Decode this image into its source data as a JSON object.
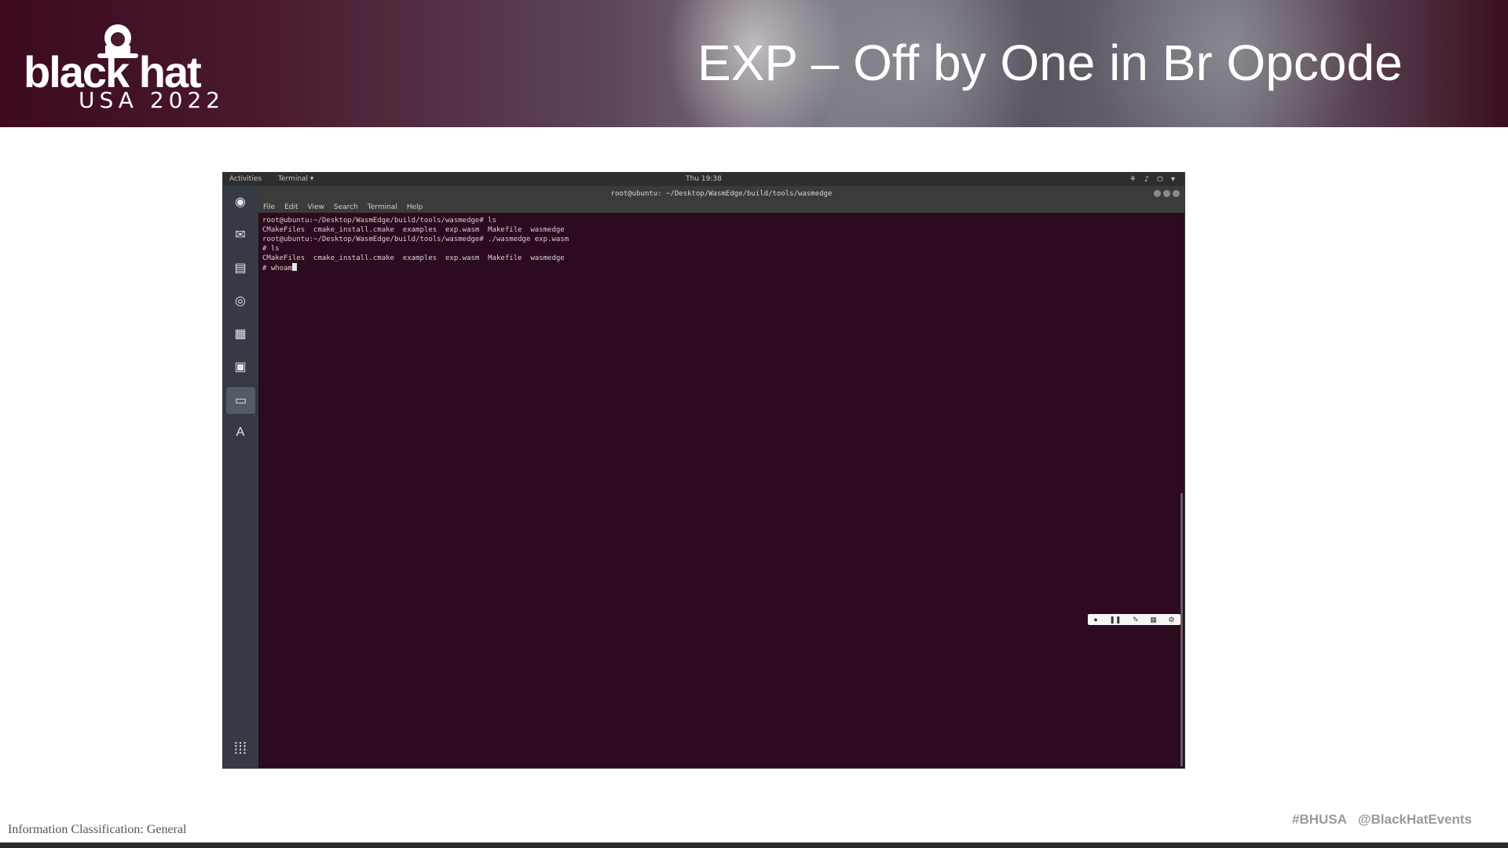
{
  "slide": {
    "logo_word": "black hat",
    "logo_sub": "USA 2022",
    "title": "EXP – Off by One in  Br Opcode"
  },
  "screenshot": {
    "topbar": {
      "activities": "Activities",
      "app_menu": "Terminal ▾",
      "clock": "Thu 19:38"
    },
    "window_title": "root@ubuntu: ~/Desktop/WasmEdge/build/tools/wasmedge",
    "menu": [
      "File",
      "Edit",
      "View",
      "Search",
      "Terminal",
      "Help"
    ],
    "terminal_lines": [
      "root@ubuntu:~/Desktop/WasmEdge/build/tools/wasmedge# ls",
      "CMakeFiles  cmake_install.cmake  examples  exp.wasm  Makefile  wasmedge",
      "root@ubuntu:~/Desktop/WasmEdge/build/tools/wasmedge# ./wasmedge exp.wasm",
      "# ls",
      "CMakeFiles  cmake_install.cmake  examples  exp.wasm  Makefile  wasmedge"
    ],
    "prompt_line": "# whoam",
    "dock_icons": [
      "firefox-icon",
      "thunderbird-icon",
      "files-icon",
      "rhythmbox-icon",
      "writer-icon",
      "software-icon",
      "terminal-icon",
      "text-icon"
    ]
  },
  "footer": {
    "classification": "Information Classification: General",
    "hashtag": "#BHUSA",
    "handle": "@BlackHatEvents"
  }
}
